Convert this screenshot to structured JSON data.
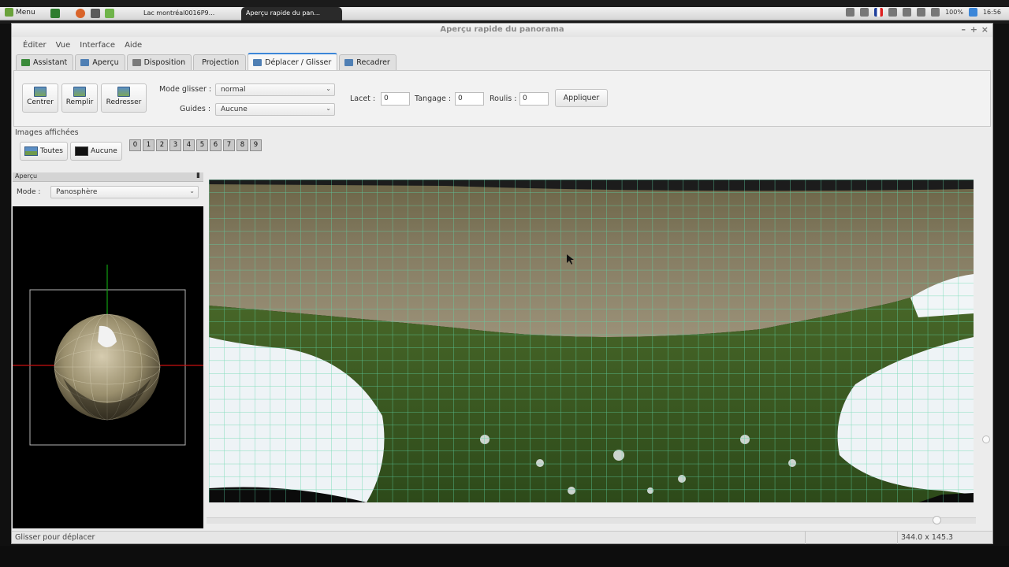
{
  "system_panel": {
    "menu_label": "Menu",
    "tasks": [
      {
        "label": "Lac montréal0016P9..."
      },
      {
        "label": "Aperçu rapide du pan..."
      }
    ],
    "tray": {
      "battery": "100%",
      "time": "16:56"
    }
  },
  "window": {
    "title": "Aperçu rapide du panorama",
    "menu": [
      "Éditer",
      "Vue",
      "Interface",
      "Aide"
    ]
  },
  "tabs": [
    {
      "label": "Assistant",
      "color": "#3a8a3a"
    },
    {
      "label": "Aperçu",
      "color": "#4f7fb4"
    },
    {
      "label": "Disposition",
      "color": "#7a7a7a"
    },
    {
      "label": "Projection",
      "color": ""
    },
    {
      "label": "Déplacer / Glisser",
      "color": "#4f7fb4",
      "active": true
    },
    {
      "label": "Recadrer",
      "color": "#4f7fb4"
    }
  ],
  "toolbar": {
    "buttons": [
      "Centrer",
      "Remplir",
      "Redresser"
    ],
    "drag_mode_label": "Mode glisser :",
    "drag_mode_value": "normal",
    "guides_label": "Guides :",
    "guides_value": "Aucune",
    "yaw_label": "Lacet :",
    "yaw_value": "0",
    "pitch_label": "Tangage :",
    "pitch_value": "0",
    "roll_label": "Roulis :",
    "roll_value": "0",
    "apply_label": "Appliquer"
  },
  "images_shown": {
    "label": "Images affichées",
    "all_label": "Toutes",
    "none_label": "Aucune",
    "numbers": [
      "0",
      "1",
      "2",
      "3",
      "4",
      "5",
      "6",
      "7",
      "8",
      "9"
    ]
  },
  "preview_panel": {
    "header": "Aperçu",
    "mode_label": "Mode :",
    "mode_value": "Panosphère"
  },
  "status": {
    "left": "Glisser pour déplacer",
    "right": "344.0 x 145.3"
  }
}
